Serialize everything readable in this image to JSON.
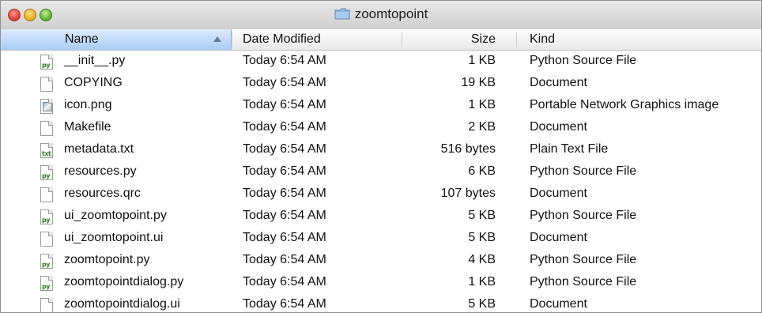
{
  "window": {
    "title": "zoomtopoint"
  },
  "columns": {
    "name": "Name",
    "date": "Date Modified",
    "size": "Size",
    "kind": "Kind"
  },
  "files": [
    {
      "name": "__init__.py",
      "date": "Today 6:54 AM",
      "size": "1 KB",
      "kind": "Python Source File",
      "icon": "python-file-icon"
    },
    {
      "name": "COPYING",
      "date": "Today 6:54 AM",
      "size": "19 KB",
      "kind": "Document",
      "icon": "document-icon"
    },
    {
      "name": "icon.png",
      "date": "Today 6:54 AM",
      "size": "1 KB",
      "kind": "Portable Network Graphics image",
      "icon": "png-image-icon"
    },
    {
      "name": "Makefile",
      "date": "Today 6:54 AM",
      "size": "2 KB",
      "kind": "Document",
      "icon": "document-icon"
    },
    {
      "name": "metadata.txt",
      "date": "Today 6:54 AM",
      "size": "516 bytes",
      "kind": "Plain Text File",
      "icon": "text-file-icon"
    },
    {
      "name": "resources.py",
      "date": "Today 6:54 AM",
      "size": "6 KB",
      "kind": "Python Source File",
      "icon": "python-file-icon"
    },
    {
      "name": "resources.qrc",
      "date": "Today 6:54 AM",
      "size": "107 bytes",
      "kind": "Document",
      "icon": "document-icon"
    },
    {
      "name": "ui_zoomtopoint.py",
      "date": "Today 6:54 AM",
      "size": "5 KB",
      "kind": "Python Source File",
      "icon": "python-file-icon"
    },
    {
      "name": "ui_zoomtopoint.ui",
      "date": "Today 6:54 AM",
      "size": "5 KB",
      "kind": "Document",
      "icon": "document-icon"
    },
    {
      "name": "zoomtopoint.py",
      "date": "Today 6:54 AM",
      "size": "4 KB",
      "kind": "Python Source File",
      "icon": "python-file-icon"
    },
    {
      "name": "zoomtopointdialog.py",
      "date": "Today 6:54 AM",
      "size": "1 KB",
      "kind": "Python Source File",
      "icon": "python-file-icon"
    },
    {
      "name": "zoomtopointdialog.ui",
      "date": "Today 6:54 AM",
      "size": "5 KB",
      "kind": "Document",
      "icon": "document-icon"
    }
  ]
}
